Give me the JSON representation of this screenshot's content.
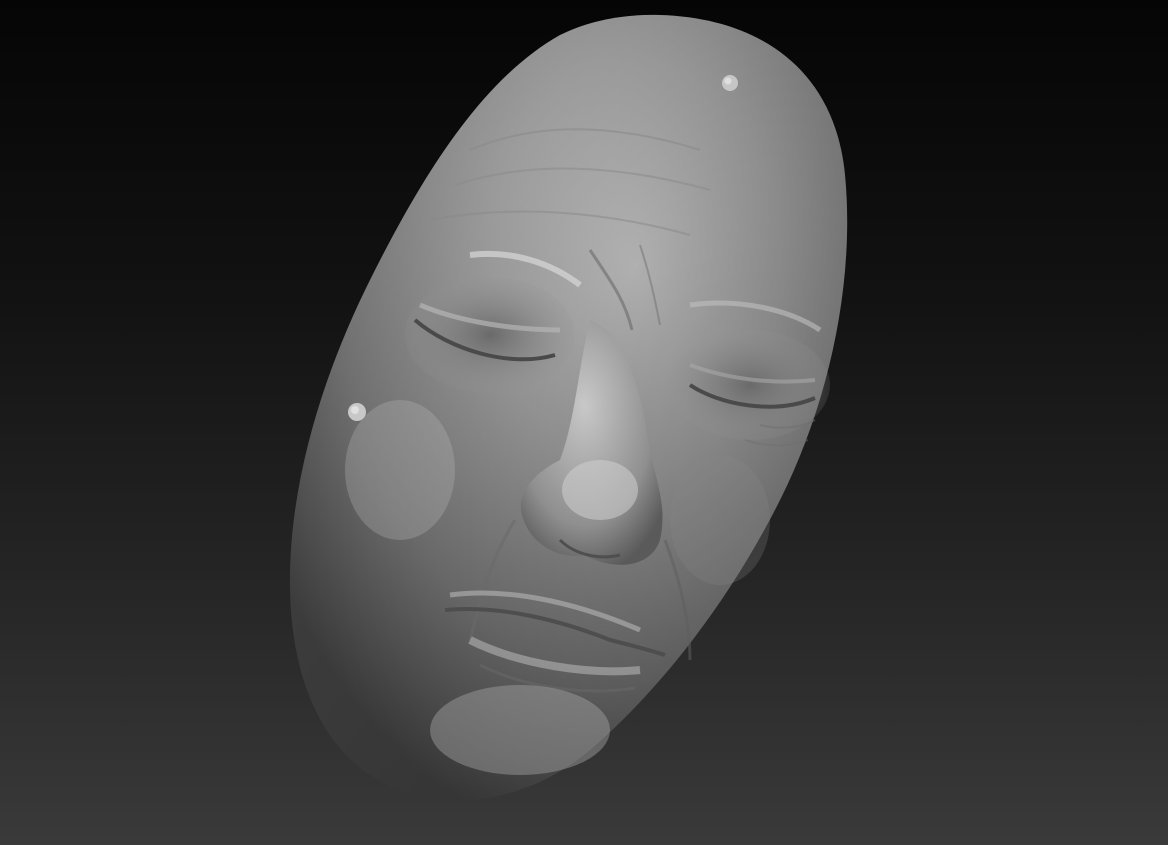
{
  "viewport": {
    "background_top": "#050505",
    "background_bottom": "#3a3a3a"
  },
  "model": {
    "subject": "sculpted-face-mask",
    "material_color": "#9a9a9a",
    "highlight_color": "#d4d4d4",
    "shadow_color": "#4a4a4a"
  }
}
